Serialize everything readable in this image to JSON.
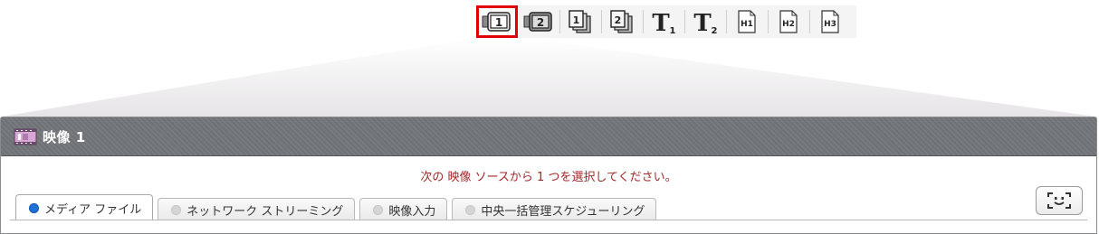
{
  "toolbar": {
    "buttons": [
      {
        "name": "video-1-button",
        "icon": "camera-1-icon",
        "glyph": "1",
        "selected": true
      },
      {
        "name": "video-2-button",
        "icon": "camera-2-icon",
        "glyph": "2",
        "selected": false
      },
      {
        "name": "layer-1-button",
        "icon": "stack-1-icon",
        "glyph": "1",
        "selected": false
      },
      {
        "name": "layer-2-button",
        "icon": "stack-2-icon",
        "glyph": "2",
        "selected": false
      },
      {
        "name": "text-1-button",
        "icon": "text-1-icon",
        "glyph": "T",
        "sub": "1",
        "selected": false
      },
      {
        "name": "text-2-button",
        "icon": "text-2-icon",
        "glyph": "T",
        "sub": "2",
        "selected": false
      },
      {
        "name": "html-1-button",
        "icon": "html-1-icon",
        "glyph": "H1",
        "selected": false
      },
      {
        "name": "html-2-button",
        "icon": "html-2-icon",
        "glyph": "H2",
        "selected": false
      },
      {
        "name": "html-3-button",
        "icon": "html-3-icon",
        "glyph": "H3",
        "selected": false
      }
    ],
    "selected_outline_color": "#e00000"
  },
  "panel": {
    "title": "映像 1",
    "icon": "film-icon",
    "instruction": "次の 映像 ソースから 1 つを選択してください。",
    "tabs": [
      {
        "label": "メディア ファイル",
        "active": true
      },
      {
        "label": "ネットワーク ストリーミング",
        "active": false
      },
      {
        "label": "映像入力",
        "active": false
      },
      {
        "label": "中央一括管理スケジューリング",
        "active": false
      }
    ],
    "capture_icon": "face-capture-icon"
  },
  "colors": {
    "header_bg": "#6e7175",
    "instruction_text": "#a0282a",
    "active_radio": "#1f6fd6"
  }
}
